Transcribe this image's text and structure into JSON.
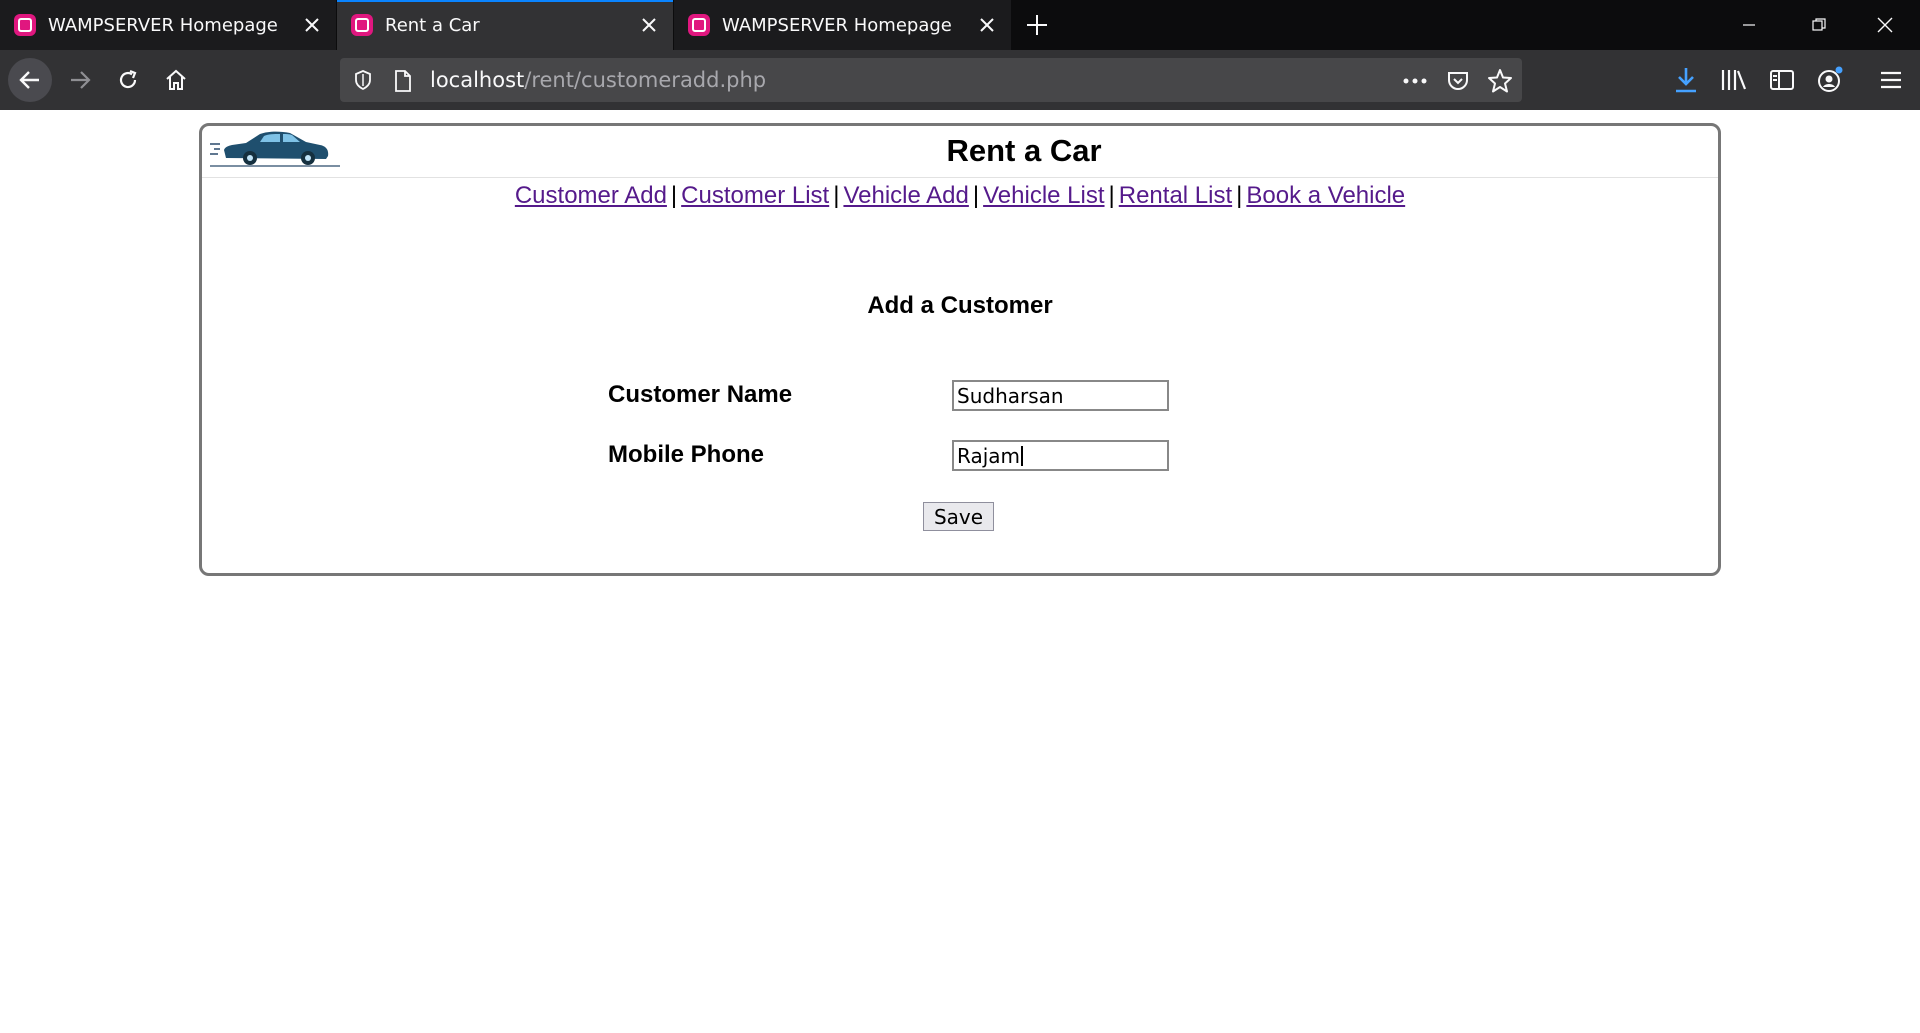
{
  "browser": {
    "tabs": [
      {
        "title": "WAMPSERVER Homepage",
        "active": false
      },
      {
        "title": "Rent a Car",
        "active": true
      },
      {
        "title": "WAMPSERVER Homepage",
        "active": false
      }
    ],
    "url": {
      "host": "localhost",
      "path": "/rent/customeradd.php"
    },
    "accent_color": "#0a84ff",
    "favicon_color": "#e0177f"
  },
  "site": {
    "title": "Rent a Car",
    "logo_icon": "car-icon",
    "nav": [
      {
        "label": "Customer Add"
      },
      {
        "label": "Customer List"
      },
      {
        "label": "Vehicle Add"
      },
      {
        "label": "Vehicle List"
      },
      {
        "label": "Rental List"
      },
      {
        "label": "Book a Vehicle"
      }
    ],
    "nav_separator": "|",
    "link_color": "#551a8b"
  },
  "form": {
    "title": "Add a Customer",
    "fields": [
      {
        "label": "Customer Name",
        "value": "Sudharsan"
      },
      {
        "label": "Mobile Phone",
        "value": "Rajam"
      }
    ],
    "save_label": "Save"
  }
}
